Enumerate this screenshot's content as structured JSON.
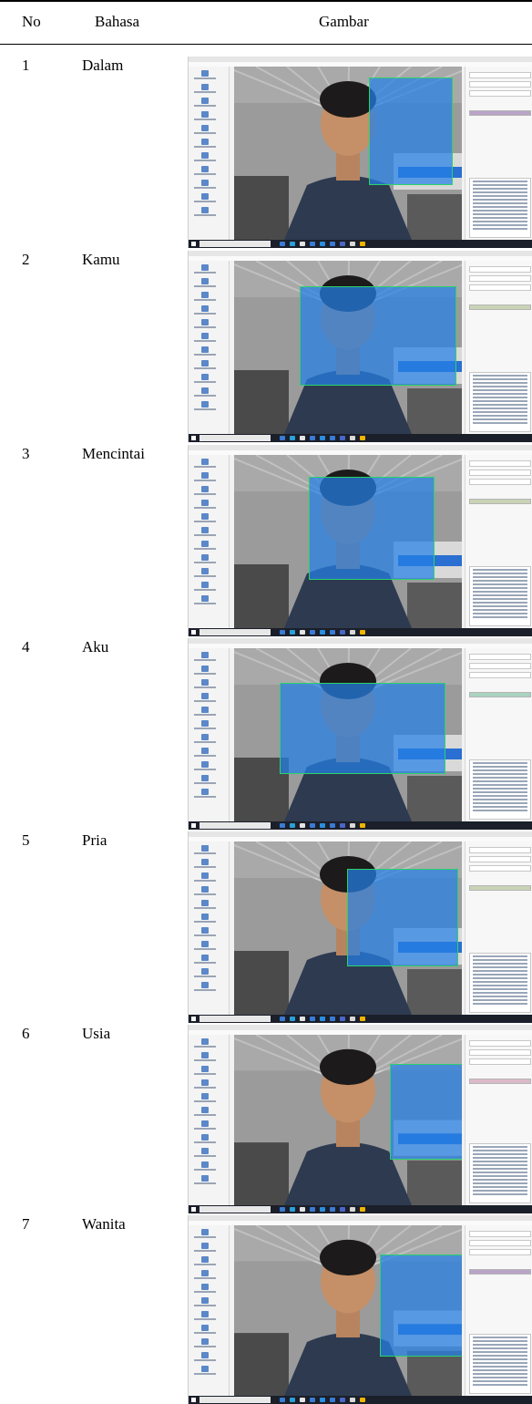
{
  "table": {
    "headers": {
      "no": "No",
      "language": "Bahasa",
      "image": "Gambar"
    },
    "rows": [
      {
        "no": "1",
        "word": "Dalam",
        "label_color": "#b9a4c8"
      },
      {
        "no": "2",
        "word": "Kamu",
        "label_color": "#c9d3b5"
      },
      {
        "no": "3",
        "word": "Mencintai",
        "label_color": "#c9d3b5"
      },
      {
        "no": "4",
        "word": "Aku",
        "label_color": "#a9d3bf"
      },
      {
        "no": "5",
        "word": "Pria",
        "label_color": "#c9d3b5"
      },
      {
        "no": "6",
        "word": "Usia",
        "label_color": "#dbb9c9"
      },
      {
        "no": "7",
        "word": "Wanita",
        "label_color": "#b9a4c8"
      }
    ]
  },
  "colors": {
    "bounding_box": "#2680e6",
    "bounding_box_edge": "#2bd36b",
    "taskbar": "#1b1f2a"
  }
}
